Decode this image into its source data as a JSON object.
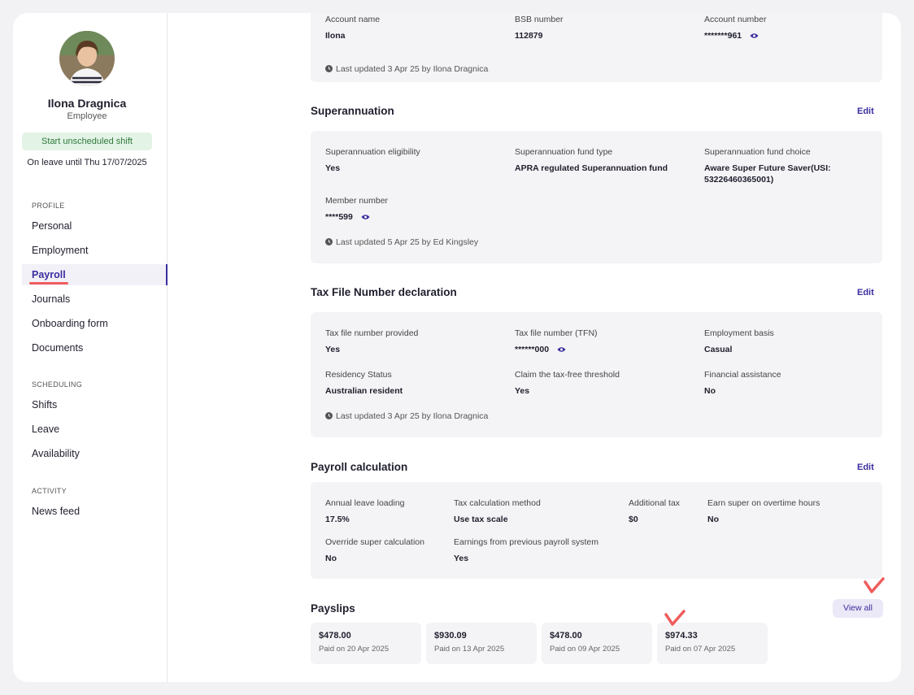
{
  "profile": {
    "name": "Ilona Dragnica",
    "role": "Employee",
    "shift_button": "Start unscheduled shift",
    "leave_note": "On leave until Thu 17/07/2025"
  },
  "nav": {
    "profile_heading": "PROFILE",
    "profile_items": [
      "Personal",
      "Employment",
      "Payroll",
      "Journals",
      "Onboarding form",
      "Documents"
    ],
    "active_item": "Payroll",
    "scheduling_heading": "SCHEDULING",
    "scheduling_items": [
      "Shifts",
      "Leave",
      "Availability"
    ],
    "activity_heading": "ACTIVITY",
    "activity_items": [
      "News feed"
    ]
  },
  "bank": {
    "account_name_label": "Account name",
    "account_name": "Ilona",
    "bsb_label": "BSB number",
    "bsb": "112879",
    "account_number_label": "Account number",
    "account_number": "*******961",
    "updated": "Last updated 3 Apr 25 by Ilona Dragnica"
  },
  "super": {
    "title": "Superannuation",
    "edit": "Edit",
    "eligibility_label": "Superannuation eligibility",
    "eligibility": "Yes",
    "fund_type_label": "Superannuation fund type",
    "fund_type": "APRA regulated Superannuation fund",
    "fund_choice_label": "Superannuation fund choice",
    "fund_choice": "Aware Super Future Saver(USI: 53226460365001)",
    "member_label": "Member number",
    "member": "****599",
    "updated": "Last updated 5 Apr 25 by Ed Kingsley"
  },
  "tfn": {
    "title": "Tax File Number declaration",
    "edit": "Edit",
    "provided_label": "Tax file number provided",
    "provided": "Yes",
    "tfn_label": "Tax file number (TFN)",
    "tfn": "******000",
    "basis_label": "Employment basis",
    "basis": "Casual",
    "residency_label": "Residency Status",
    "residency": "Australian resident",
    "threshold_label": "Claim the tax-free threshold",
    "threshold": "Yes",
    "assist_label": "Financial assistance",
    "assist": "No",
    "updated": "Last updated 3 Apr 25 by Ilona Dragnica"
  },
  "calc": {
    "title": "Payroll calculation",
    "edit": "Edit",
    "loading_label": "Annual leave loading",
    "loading": "17.5%",
    "method_label": "Tax calculation method",
    "method": "Use tax scale",
    "additional_label": "Additional tax",
    "additional": "$0",
    "overtime_label": "Earn super on overtime hours",
    "overtime": "No",
    "override_label": "Override super calculation",
    "override": "No",
    "previous_label": "Earnings from previous payroll system",
    "previous": "Yes"
  },
  "payslips": {
    "title": "Payslips",
    "view_all": "View all",
    "items": [
      {
        "amount": "$478.00",
        "date": "Paid on 20 Apr 2025"
      },
      {
        "amount": "$930.09",
        "date": "Paid on 13 Apr 2025"
      },
      {
        "amount": "$478.00",
        "date": "Paid on 09 Apr 2025"
      },
      {
        "amount": "$974.33",
        "date": "Paid on 07 Apr 2025"
      }
    ]
  },
  "colors": {
    "accent": "#3a2e9e",
    "annotation": "#ef5d5d",
    "success_bg": "#e3f3e6",
    "success_text": "#2f7a3b"
  },
  "icons": [
    "eye-icon",
    "clock-icon",
    "checkmark-annotation-icon"
  ]
}
